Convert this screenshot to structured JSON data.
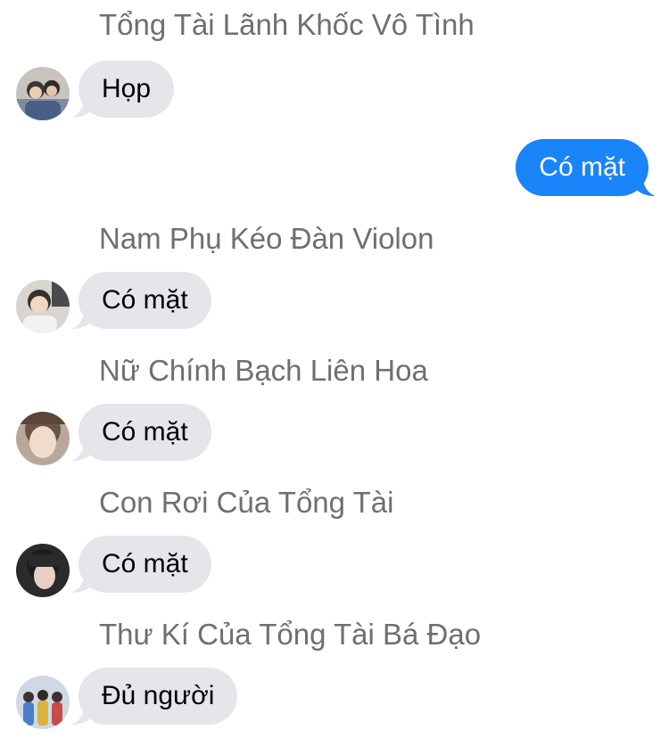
{
  "colors": {
    "incoming_bubble": "#e5e5ea",
    "outgoing_bubble": "#1a84f9",
    "sender_name": "#6e6e73",
    "background": "#ffffff"
  },
  "messages": [
    {
      "direction": "incoming",
      "sender": "Tổng Tài Lãnh Khốc Vô Tình",
      "text": "Họp",
      "avatar_icon": "group-photo-avatar"
    },
    {
      "direction": "outgoing",
      "text": "Có mặt"
    },
    {
      "direction": "incoming",
      "sender": "Nam Phụ Kéo Đàn Violon",
      "text": "Có mặt",
      "avatar_icon": "person-photo-avatar"
    },
    {
      "direction": "incoming",
      "sender": "Nữ Chính Bạch Liên Hoa",
      "text": "Có mặt",
      "avatar_icon": "person-photo-avatar"
    },
    {
      "direction": "incoming",
      "sender": "Con Rơi Của Tổng Tài",
      "text": "Có mặt",
      "avatar_icon": "person-photo-avatar"
    },
    {
      "direction": "incoming",
      "sender": "Thư Kí Của Tổng Tài Bá Đạo",
      "text": "Đủ người",
      "avatar_icon": "group-photo-avatar"
    }
  ]
}
